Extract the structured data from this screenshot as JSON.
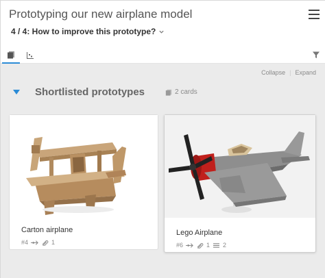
{
  "header": {
    "title": "Prototyping our new airplane model",
    "step": "4 / 4: How to improve this prototype?"
  },
  "toolbar": {
    "collapse_label": "Collapse",
    "expand_label": "Expand"
  },
  "group": {
    "title": "Shortlisted prototypes",
    "count_label": "2 cards"
  },
  "cards": [
    {
      "title": "Carton airplane",
      "id": "#4",
      "attachments": "1"
    },
    {
      "title": "Lego Airplane",
      "id": "#6",
      "attachments": "1",
      "comments": "2"
    }
  ],
  "colors": {
    "accent": "#2b8bd6",
    "background": "#ebebeb",
    "card": "#ffffff"
  }
}
